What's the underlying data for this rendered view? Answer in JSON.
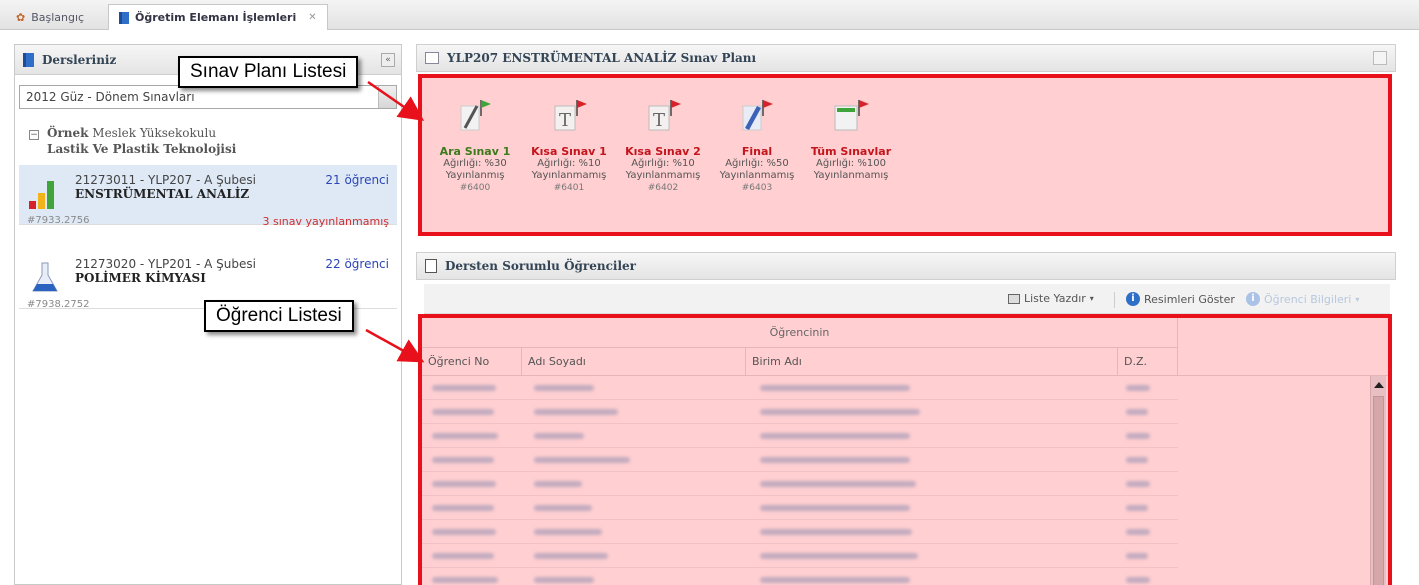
{
  "tabs": [
    {
      "label": "Başlangıç"
    },
    {
      "label": "Öğretim Elemanı İşlemleri"
    }
  ],
  "left_panel": {
    "title": "Dersleriniz",
    "term_select": "2012 Güz - Dönem Sınavları",
    "school_prefix": "Örnek",
    "school_name": "Meslek Yüksekokulu",
    "program": "Lastik Ve Plastik Teknolojisi",
    "courses": [
      {
        "code": "21273011 - YLP207 - A Şubesi",
        "name": "ENSTRÜMENTAL ANALİZ",
        "count": "21 öğrenci",
        "id": "#7933.2756",
        "warning": "3 sınav yayınlanmamış"
      },
      {
        "code": "21273020 - YLP201 - A Şubesi",
        "name": "POLİMER KİMYASI",
        "count": "22 öğrenci",
        "id": "#7938.2752",
        "warning": ""
      }
    ]
  },
  "exam_panel": {
    "title": "YLP207 ENSTRÜMENTAL ANALİZ Sınav Planı",
    "exams": [
      {
        "name": "Ara Sınav 1",
        "weight": "Ağırlığı: %30",
        "status": "Yayınlanmış",
        "id": "#6400",
        "color": "#3d7a1c"
      },
      {
        "name": "Kısa Sınav 1",
        "weight": "Ağırlığı: %10",
        "status": "Yayınlanmamış",
        "id": "#6401",
        "color": "#c4151d"
      },
      {
        "name": "Kısa Sınav 2",
        "weight": "Ağırlığı: %10",
        "status": "Yayınlanmamış",
        "id": "#6402",
        "color": "#c4151d"
      },
      {
        "name": "Final",
        "weight": "Ağırlığı: %50",
        "status": "Yayınlanmamış",
        "id": "#6403",
        "color": "#c4151d"
      },
      {
        "name": "Tüm Sınavlar",
        "weight": "Ağırlığı: %100",
        "status": "Yayınlanmamış",
        "id": "",
        "color": "#c4151d"
      }
    ]
  },
  "callouts": {
    "plan": "Sınav Planı Listesi",
    "students": "Öğrenci Listesi"
  },
  "students_panel": {
    "title": "Dersten Sorumlu Öğrenciler",
    "toolbar": {
      "print": "Liste Yazdır",
      "show_photos": "Resimleri Göster",
      "student_info": "Öğrenci Bilgileri"
    },
    "group_header": "Öğrencinin",
    "columns": [
      "Öğrenci No",
      "Adı Soyadı",
      "Birim Adı",
      "D.Z."
    ]
  },
  "colors": {
    "highlight_border": "#e8101a",
    "highlight_fill": "#ffcfd1",
    "published": "#3d7a1c",
    "unpublished": "#c4151d",
    "link": "#2a46b8"
  }
}
